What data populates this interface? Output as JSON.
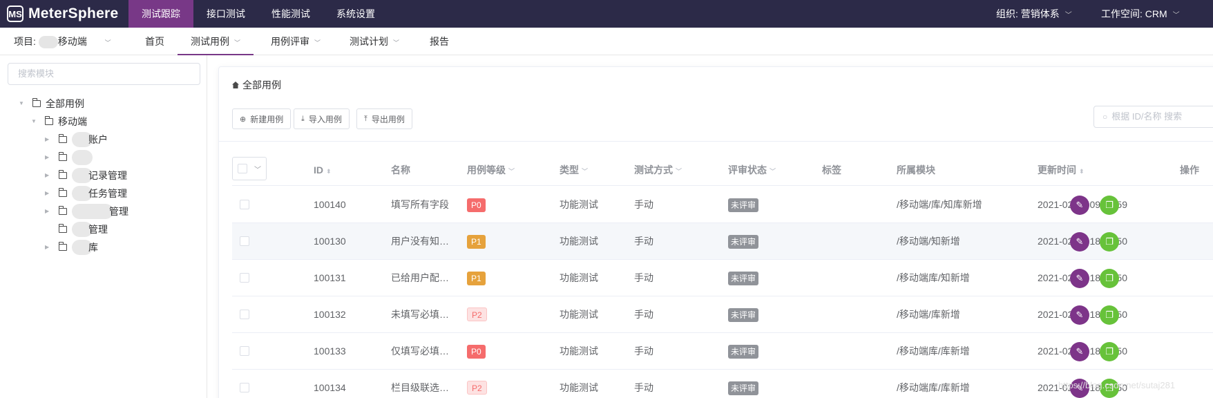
{
  "app": {
    "logo_mark": "MS",
    "name": "MeterSphere"
  },
  "topnav": [
    {
      "label": "测试跟踪",
      "active": true
    },
    {
      "label": "接口测试",
      "active": false
    },
    {
      "label": "性能测试",
      "active": false
    },
    {
      "label": "系统设置",
      "active": false
    }
  ],
  "org_label": "组织: 营销体系",
  "workspace_label": "工作空间: CRM",
  "subnav": {
    "project_prefix": "项目:",
    "project_name": "移动端",
    "items": [
      {
        "label": "首页",
        "has_caret": false
      },
      {
        "label": "测试用例",
        "has_caret": true,
        "active": true
      },
      {
        "label": "用例评审",
        "has_caret": true
      },
      {
        "label": "测试计划",
        "has_caret": true
      },
      {
        "label": "报告",
        "has_caret": false
      }
    ]
  },
  "sidebar": {
    "search_placeholder": "搜索模块",
    "tree": [
      {
        "label": "全部用例",
        "expanded": true
      },
      {
        "label": "移动端",
        "expanded": true
      },
      {
        "label": "账户"
      },
      {
        "label": ""
      },
      {
        "label": "记录管理"
      },
      {
        "label": "任务管理"
      },
      {
        "label": "管理"
      },
      {
        "label": "管理"
      },
      {
        "label": "库"
      }
    ]
  },
  "main": {
    "breadcrumb": "全部用例",
    "buttons": {
      "new": "新建用例",
      "import": "导入用例",
      "export": "导出用例"
    },
    "search_placeholder": "根据 ID/名称 搜索"
  },
  "table": {
    "headers": {
      "id": "ID",
      "name": "名称",
      "priority": "用例等级",
      "type": "类型",
      "method": "测试方式",
      "review": "评审状态",
      "tags": "标签",
      "module": "所属模块",
      "updated": "更新时间",
      "ops": "操作"
    },
    "rows": [
      {
        "id": "100140",
        "name": "填写所有字段",
        "priority": "P0",
        "type": "功能测试",
        "method": "手动",
        "review": "未评审",
        "module": "/移动端/库/知库新增",
        "updated": "2021-02-10 09:48:59"
      },
      {
        "id": "100130",
        "name": "用户没有知…",
        "priority": "P1",
        "type": "功能测试",
        "method": "手动",
        "review": "未评审",
        "module": "/移动端/知新增",
        "updated": "2021-02-09 18:01:50"
      },
      {
        "id": "100131",
        "name": "已给用户配…",
        "priority": "P1",
        "type": "功能测试",
        "method": "手动",
        "review": "未评审",
        "module": "/移动端库/知新增",
        "updated": "2021-02-09 18:01:50"
      },
      {
        "id": "100132",
        "name": "未填写必填…",
        "priority": "P2",
        "type": "功能测试",
        "method": "手动",
        "review": "未评审",
        "module": "/移动端/库新增",
        "updated": "2021-02-09 18:01:50"
      },
      {
        "id": "100133",
        "name": "仅填写必填…",
        "priority": "P0",
        "type": "功能测试",
        "method": "手动",
        "review": "未评审",
        "module": "/移动端库/库新增",
        "updated": "2021-02-09 18:01:50"
      },
      {
        "id": "100134",
        "name": "栏目级联选…",
        "priority": "P2",
        "type": "功能测试",
        "method": "手动",
        "review": "未评审",
        "module": "/移动端库/库新增",
        "updated": "2021-02-09 18:01:50"
      }
    ]
  },
  "priority_colors": {
    "P0": "#f56c6c",
    "P1": "#e6a23c",
    "P2": "#fde2e2"
  },
  "icons": {
    "edit": "pencil-icon",
    "copy": "copy-icon",
    "home": "home-icon",
    "search": "search-icon"
  },
  "watermark": "https://blog.csdn.net/sutaj281"
}
